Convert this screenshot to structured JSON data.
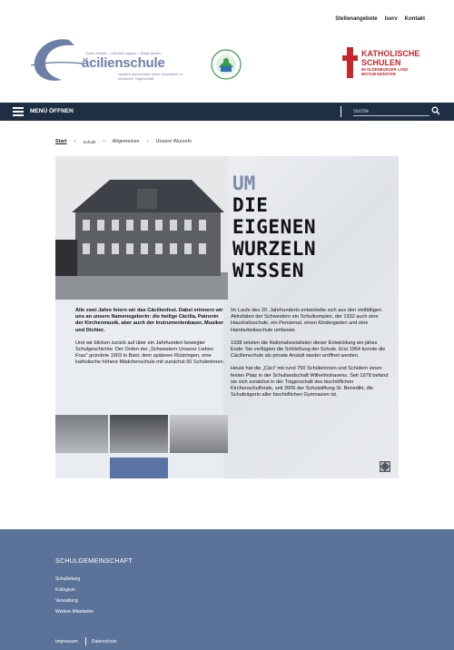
{
  "top_nav": {
    "items": [
      "Stellenangebote",
      "Iserv",
      "Kontakt"
    ]
  },
  "logo": {
    "name": "äcilienschule",
    "motto": "Gutes Reden – Glauben wagen – Wege finden",
    "subtitle": "staatlich anerkanntes freies Gymnasium in kirchlicher Trägerschaft"
  },
  "partner_logo": {
    "line1": "KATHOLISCHE",
    "line2": "SCHULEN",
    "line3": "IM OLDENBURGER LAND",
    "line4": "BISTUM MÜNSTER"
  },
  "navbar": {
    "menu_label": "MENÜ ÖFFNEN",
    "search_placeholder": "Suche"
  },
  "breadcrumb": {
    "items": [
      "Start",
      "Schule",
      "Allgemeines",
      "Unsere Wurzeln"
    ]
  },
  "hero": {
    "headline_um": "UM",
    "headline_lines": [
      "DIE",
      "EIGENEN",
      "WURZELN",
      "WISSEN"
    ],
    "left_bold": "Alle zwei Jahre feiern wir das Cäcilienfest. Dabei erinnern wir uns an unsere Namensgeberin: die heilige Cäcilia, Patronin der Kirchenmusik, aber auch der Instrumentenbauer, Musiker und Dichter.",
    "left_text": "Und wir blicken zurück auf über ein Jahrhundert bewegter Schulgeschichte: Der Orden der „Schwestern Unserer Lieben Frau\" gründete 1903 in Bant, dem späteren Rüstringen, eine katholische höhere Mädchenschule mit zunächst 60 Schülerinnen.",
    "right_paragraphs": [
      "Im Laufe des 20. Jahrhunderts entwickelte sich aus den vielfältigen Aktivitäten der Schwestern ein Schulkomplex, der 1932 auch eine Haushaltsschule, ein Pensionat, einen Kindergarten und eine Handarbeitsschule umfasste.",
      "1938 setzten die Nationalsozialisten dieser Entwicklung ein jähes Ende: Sie verfügten die Schließung der Schule. Erst 1954 konnte die Cäcilienschule als private Anstalt wieder eröffnet werden.",
      "Heute hat die „Cäci\" mit rund 750 Schülerinnen und Schülern einen festen Platz in der Schullandschaft Wilhelmshavens. Seit 1978 befand sie sich zunächst in der Trägerschaft des bischöflichen Kirchenschulfonds, seit 2006 der Schulstiftung St. Benedikt, die Schulträgerin aller bischöflichen Gymnasien ist."
    ]
  },
  "footer": {
    "title": "SCHULGEMEINSCHAFT",
    "links": [
      "Schulleitung",
      "Kollegium",
      "Verwaltung",
      "Weitere Mitarbeiter"
    ],
    "bottom": [
      "Impressum",
      "Datenschutz"
    ]
  },
  "colors": {
    "navbar": "#1e2f44",
    "footer": "#5c7399",
    "accent_red": "#c8262c",
    "logo_blue": "#6d7fa6"
  }
}
